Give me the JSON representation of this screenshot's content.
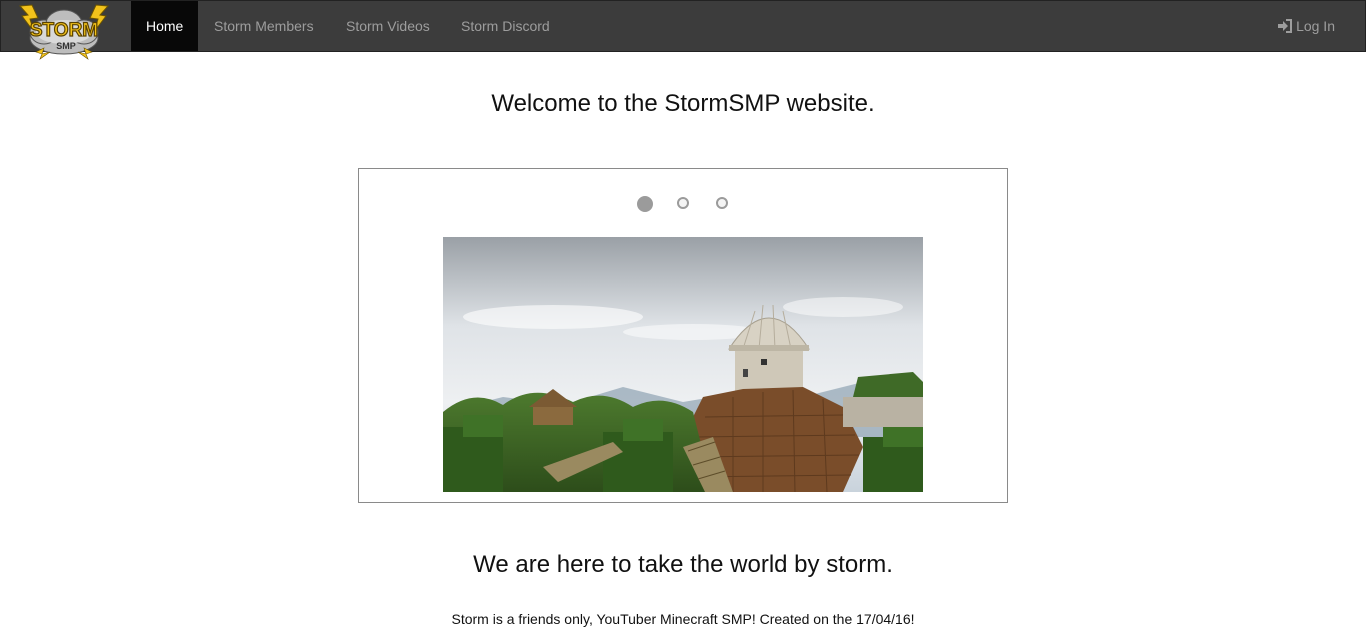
{
  "nav": {
    "items": [
      {
        "label": "Home",
        "active": true
      },
      {
        "label": "Storm Members",
        "active": false
      },
      {
        "label": "Storm Videos",
        "active": false
      },
      {
        "label": "Storm Discord",
        "active": false
      }
    ],
    "login_label": "Log In",
    "login_icon": "sign-in-icon"
  },
  "logo": {
    "main": "STORM",
    "sub": "SMP"
  },
  "main": {
    "welcome": "Welcome to the StormSMP website.",
    "headline": "We are here to take the world by storm.",
    "tagline": "Storm is a friends only, YouTuber Minecraft SMP! Created on the 17/04/16!"
  },
  "carousel": {
    "slide_count": 3,
    "active_index": 0
  },
  "colors": {
    "navbar_bg": "#3c3c3c",
    "nav_active_bg": "#080808",
    "nav_text": "#9d9d9d",
    "logo_gold": "#f2c21b"
  }
}
